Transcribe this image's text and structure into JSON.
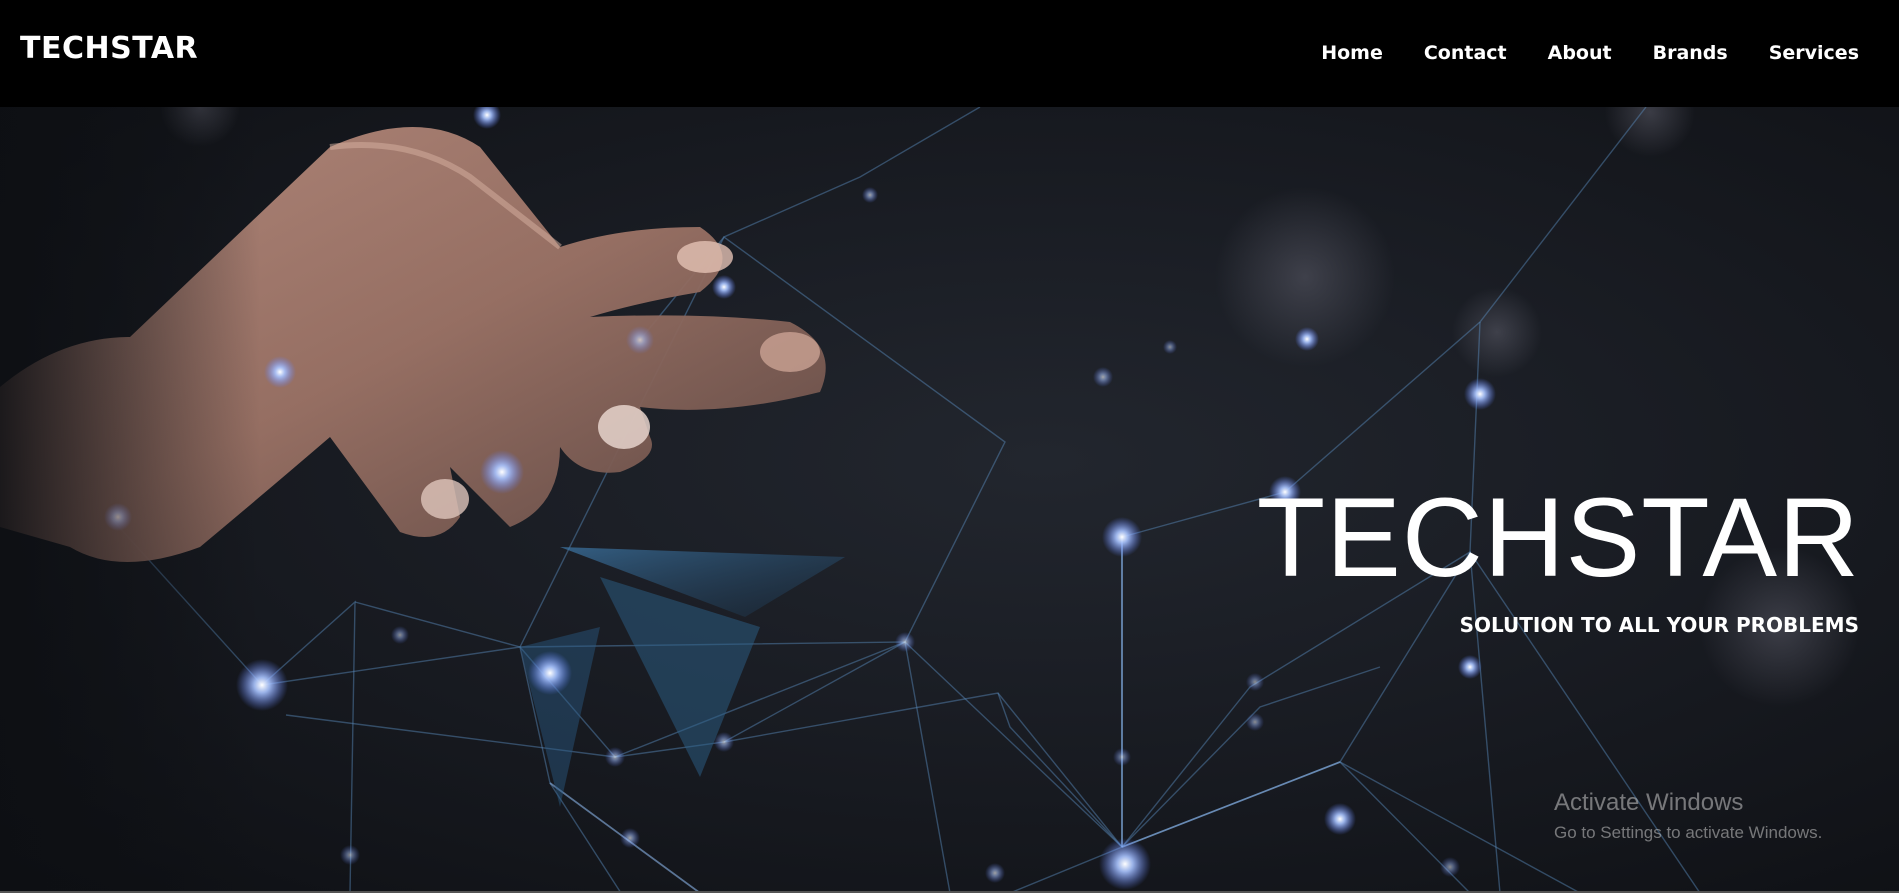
{
  "navbar": {
    "brand": "TECHSTAR",
    "links": [
      "Home",
      "Contact",
      "About",
      "Brands",
      "Services"
    ]
  },
  "hero": {
    "title": "TECHSTAR",
    "subtitle": "SOLUTION TO ALL YOUR PROBLEMS",
    "image": "hand-touching-network-image"
  },
  "watermark": {
    "title": "Activate Windows",
    "subtitle": "Go to Settings to activate Windows."
  },
  "colors": {
    "navbar_bg": "#000000",
    "text": "#ffffff",
    "network_glow": "#7fa8ff"
  }
}
